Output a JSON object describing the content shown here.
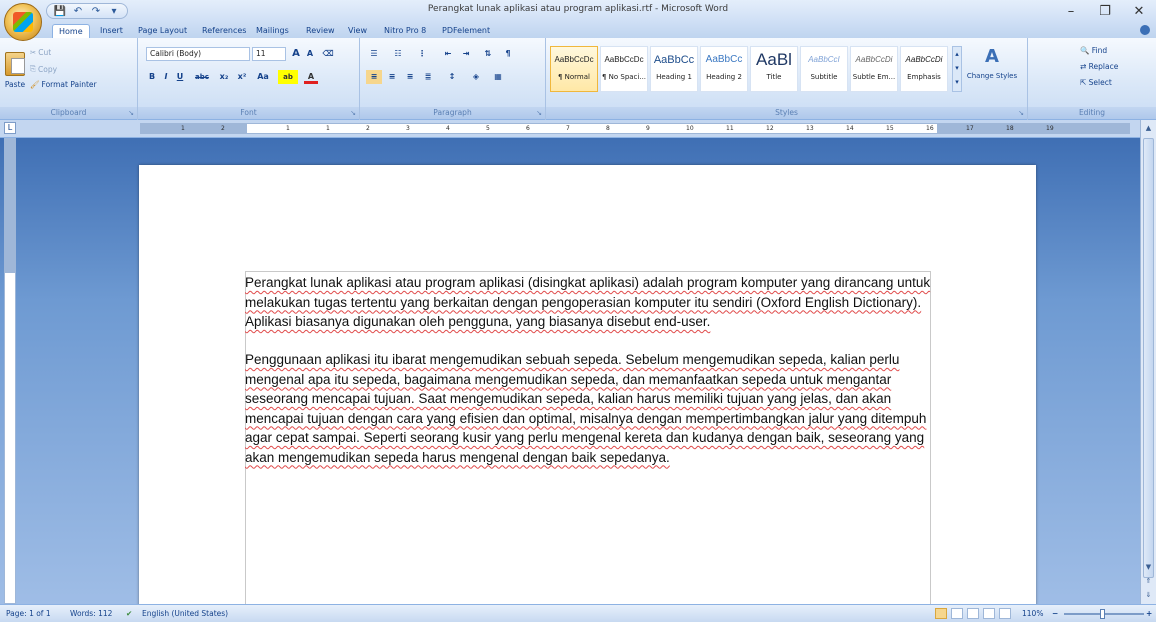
{
  "window": {
    "title": "Perangkat lunak aplikasi atau program aplikasi.rtf - Microsoft Word",
    "minimize": "–",
    "maximize": "❐",
    "close": "✕"
  },
  "qat": {
    "save": "💾",
    "undo": "↶",
    "redo": "↷",
    "more": "▾"
  },
  "tabs": [
    "Home",
    "Insert",
    "Page Layout",
    "References",
    "Mailings",
    "Review",
    "View",
    "Nitro Pro 8",
    "PDFelement"
  ],
  "ribbon": {
    "clipboard": {
      "label": "Clipboard",
      "paste": "Paste",
      "cut": "Cut",
      "copy": "Copy",
      "format_painter": "Format Painter"
    },
    "font": {
      "label": "Font",
      "font_name": "Calibri (Body)",
      "font_size": "11",
      "grow": "A",
      "shrink": "A",
      "clear": "⌫",
      "bold": "B",
      "italic": "I",
      "underline": "U",
      "strike": "abc",
      "subscript": "x₂",
      "superscript": "x²",
      "change_case": "Aa",
      "highlight": "ab",
      "font_color": "A"
    },
    "paragraph": {
      "label": "Paragraph"
    },
    "styles": {
      "label": "Styles",
      "items": [
        {
          "preview": "AaBbCcDc",
          "name": "¶ Normal"
        },
        {
          "preview": "AaBbCcDc",
          "name": "¶ No Spaci..."
        },
        {
          "preview": "AaBbCc",
          "name": "Heading 1"
        },
        {
          "preview": "AaBbCc",
          "name": "Heading 2"
        },
        {
          "preview": "AaBl",
          "name": "Title"
        },
        {
          "preview": "AaBbCcI",
          "name": "Subtitle"
        },
        {
          "preview": "AaBbCcDi",
          "name": "Subtle Em..."
        },
        {
          "preview": "AaBbCcDi",
          "name": "Emphasis"
        }
      ],
      "change_styles": "Change Styles"
    },
    "editing": {
      "label": "Editing",
      "find": "Find",
      "replace": "Replace",
      "select": "Select"
    }
  },
  "ruler": {
    "ticks": [
      "1",
      "2",
      "1",
      "1",
      "2",
      "3",
      "4",
      "5",
      "6",
      "7",
      "8",
      "9",
      "10",
      "11",
      "12",
      "13",
      "14",
      "15",
      "16",
      "17",
      "18",
      "19"
    ]
  },
  "document": {
    "paragraphs": [
      "Perangkat lunak aplikasi atau program aplikasi (disingkat aplikasi) adalah program komputer yang dirancang untuk melakukan tugas tertentu yang berkaitan dengan pengoperasian komputer itu sendiri (Oxford English Dictionary). Aplikasi biasanya digunakan oleh pengguna, yang biasanya disebut end-user.",
      "Penggunaan aplikasi itu ibarat mengemudikan sebuah sepeda. Sebelum mengemudikan sepeda, kalian perlu mengenal apa itu sepeda, bagaimana mengemudikan sepeda, dan memanfaatkan sepeda untuk mengantar seseorang mencapai tujuan. Saat mengemudikan sepeda, kalian harus memiliki tujuan yang jelas, dan akan mencapai tujuan dengan cara yang efisien dan optimal, misalnya dengan mempertimbangkan jalur yang ditempuh agar cepat sampai. Seperti seorang kusir yang perlu mengenal kereta dan kudanya dengan baik, seseorang yang akan mengemudikan sepeda harus mengenal dengan baik sepedanya."
    ]
  },
  "status": {
    "page": "Page: 1 of 1",
    "words": "Words: 112",
    "language": "English (United States)",
    "zoom": "110%",
    "zoom_minus": "−",
    "zoom_plus": "+"
  },
  "colors": {
    "accent": "#15428b",
    "spell": "#e04a4a"
  }
}
